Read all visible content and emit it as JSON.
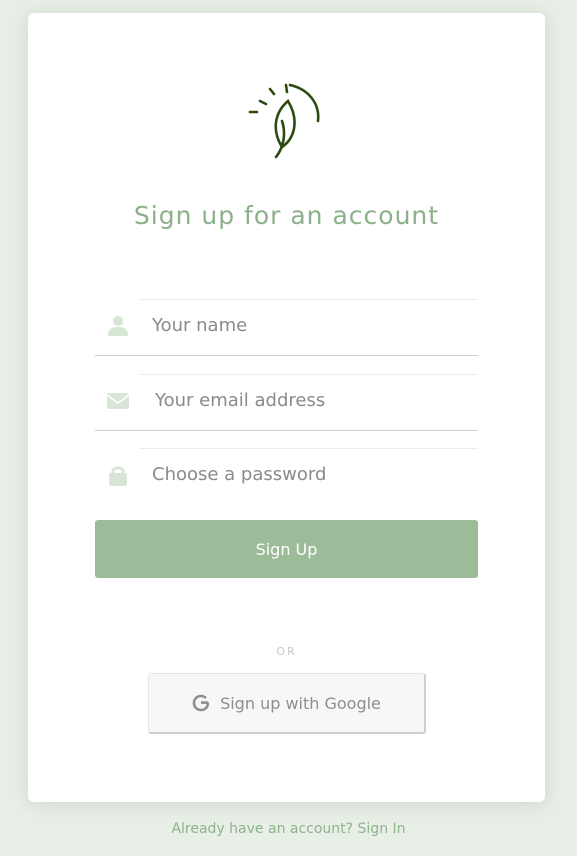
{
  "form": {
    "title": "Sign up for an account",
    "fields": [
      {
        "icon": "user-icon",
        "placeholder": "Your name",
        "value": ""
      },
      {
        "icon": "envelope-icon",
        "placeholder": "Your email address",
        "value": ""
      },
      {
        "icon": "lock-icon",
        "placeholder": "Choose a password",
        "value": ""
      }
    ],
    "submit_label": "Sign Up",
    "divider": "OR",
    "google_label": "Sign up with Google"
  },
  "footer": {
    "prompt": "Already have an account?",
    "link_label": "Sign In"
  },
  "colors": {
    "accent": "#9bbb99",
    "title": "#8db08b",
    "icon": "#d7e6d5",
    "logo": "#2c4a12"
  }
}
